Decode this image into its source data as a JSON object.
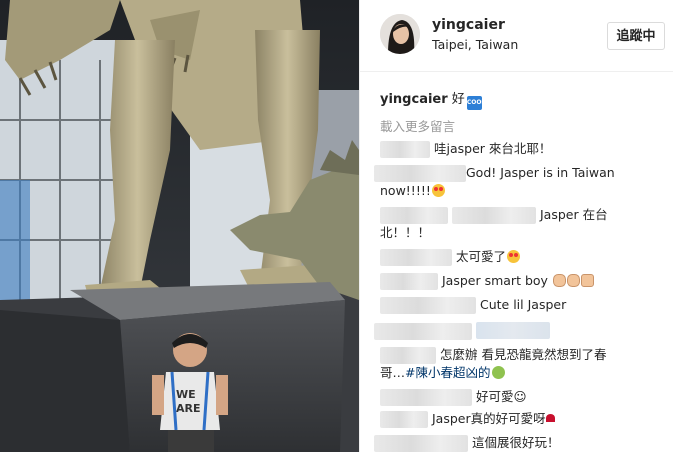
{
  "post": {
    "username": "yingcaier",
    "location": "Taipei, Taiwan",
    "follow_label": "追蹤中"
  },
  "caption": {
    "username": "yingcaier",
    "text": "好",
    "badge": "COOL"
  },
  "load_more": "載入更多留言",
  "comments": [
    {
      "text": "哇jasper 來台北耶！"
    },
    {
      "line1": "God! Jasper is in Taiwan",
      "line2": "now!!!!!",
      "emoji": "heart-eyes-emoji"
    },
    {
      "line1": "Jasper 在台",
      "line2": "北！！！"
    },
    {
      "text": "太可愛了",
      "emoji": "heart-eyes-emoji"
    },
    {
      "text": "Jasper smart boy",
      "emoji": "clap-emoji, thumbs-up-emoji"
    },
    {
      "text": "Cute lil Jasper"
    },
    {
      "text": ""
    },
    {
      "line1": "怎麼辦 看見恐龍竟然想到了春",
      "line2_a": "哥…",
      "line2_tag": "#陳小春超凶的",
      "emoji": "grinning-face-emoji"
    },
    {
      "text": "好可愛☺"
    },
    {
      "text": "Jasper真的好可愛呀",
      "emoji": "red-heart-emoji"
    },
    {
      "text": "這個展很好玩！"
    }
  ]
}
